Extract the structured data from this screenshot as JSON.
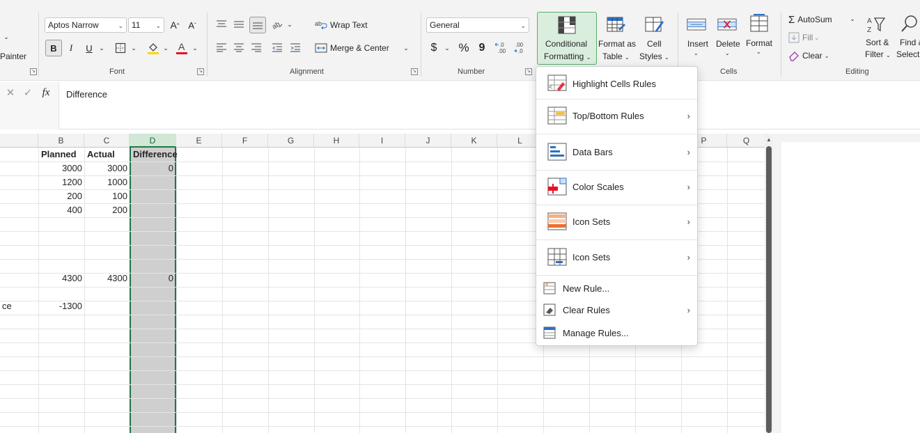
{
  "ribbon": {
    "clipboard": {
      "painter_label": "Painter"
    },
    "font": {
      "group_label": "Font",
      "font_name": "Aptos Narrow",
      "font_size": "11",
      "bold": "B",
      "italic": "I",
      "underline": "U",
      "grow": "A",
      "shrink": "A"
    },
    "alignment": {
      "group_label": "Alignment",
      "wrap_text": "Wrap Text",
      "merge_center": "Merge & Center"
    },
    "number": {
      "group_label": "Number",
      "format": "General",
      "currency": "$",
      "percent": "%",
      "comma": "9",
      "inc_decimal": "←.0\n.00",
      "dec_decimal": ".00\n→.0"
    },
    "styles": {
      "conditional_formatting_line1": "Conditional",
      "conditional_formatting_line2": "Formatting",
      "format_as_table_line1": "Format as",
      "format_as_table_line2": "Table",
      "cell_styles_line1": "Cell",
      "cell_styles_line2": "Styles"
    },
    "cells": {
      "group_label": "Cells",
      "insert": "Insert",
      "delete": "Delete",
      "format": "Format"
    },
    "editing": {
      "group_label": "Editing",
      "autosum": "AutoSum",
      "fill": "Fill",
      "clear": "Clear",
      "sort_filter_line1": "Sort &",
      "sort_filter_line2": "Filter",
      "find_select_line1": "Find &",
      "find_select_line2": "Select"
    }
  },
  "formula_bar": {
    "fx": "fx",
    "value": "Difference"
  },
  "sheet": {
    "columns": [
      "B",
      "C",
      "D",
      "E",
      "F",
      "G",
      "H",
      "I",
      "J",
      "K",
      "L",
      "P",
      "Q"
    ],
    "selected_column": "D",
    "cells": {
      "b1": "Planned",
      "c1": "Actual",
      "d1": "Difference",
      "b2": "3000",
      "c2": "3000",
      "d2": "0",
      "b3": "1200",
      "c3": "1000",
      "b4": "200",
      "c4": "100",
      "b5": "400",
      "c5": "200",
      "b10": "4300",
      "c10": "4300",
      "d10": "0",
      "a12": "ce",
      "b12": "-1300"
    }
  },
  "cf_menu": {
    "items": [
      {
        "label": "Highlight Cells Rules",
        "has_submenu": false
      },
      {
        "label": "Top/Bottom Rules",
        "has_submenu": true
      },
      {
        "label": "Data Bars",
        "has_submenu": true
      },
      {
        "label": "Color Scales",
        "has_submenu": true
      },
      {
        "label": "Icon Sets",
        "has_submenu": true
      },
      {
        "label": "Icon Sets",
        "has_submenu": true
      },
      {
        "label": "New Rule...",
        "has_submenu": false
      },
      {
        "label": "Clear Rules",
        "has_submenu": true
      },
      {
        "label": "Manage Rules...",
        "has_submenu": false
      }
    ]
  },
  "colors": {
    "accent_green": "#217346",
    "selected_fill": "#cfcfcf",
    "font_color_red": "#e81123",
    "highlight_yellow": "#ffd400"
  }
}
